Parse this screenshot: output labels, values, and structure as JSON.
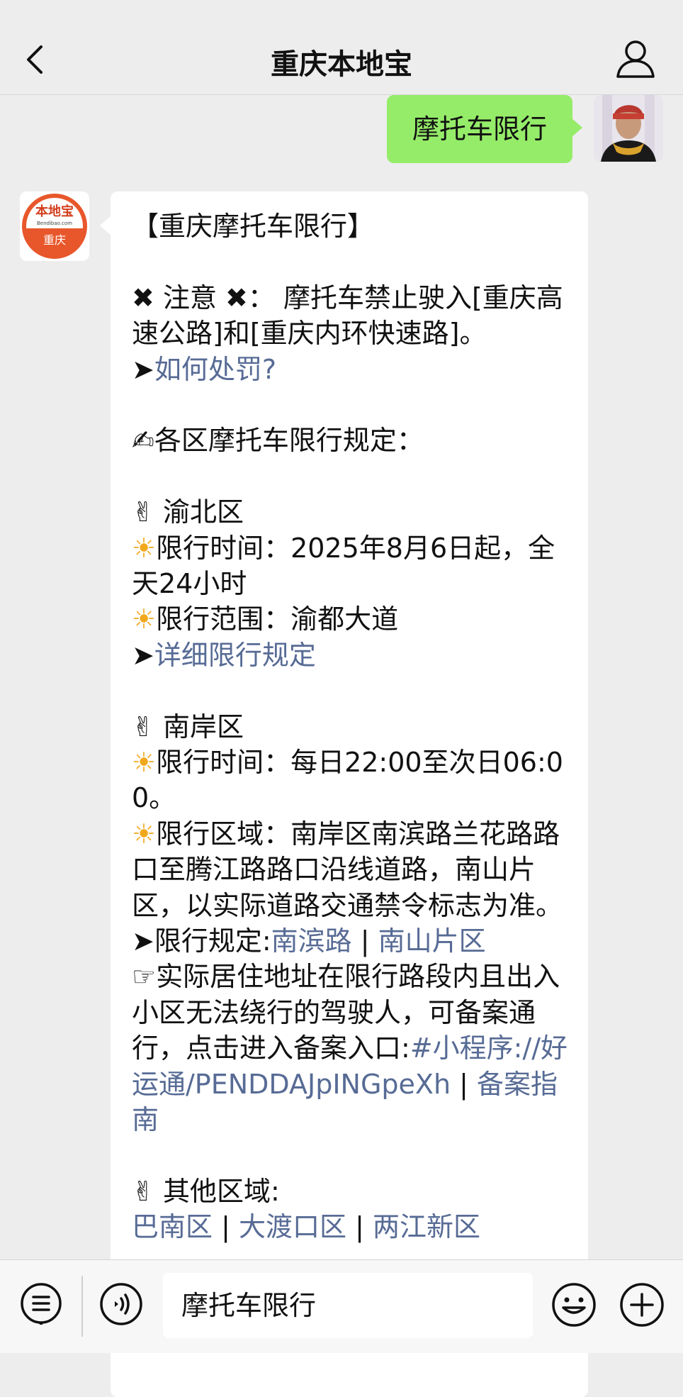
{
  "header": {
    "title": "重庆本地宝"
  },
  "user_message": {
    "text": "摩托车限行"
  },
  "bot_avatar": {
    "brand": "本地宝",
    "domain": "Bendibao.com",
    "city": "重庆"
  },
  "reply": {
    "title": "【重庆摩托车限行】",
    "notice_label": "注意",
    "notice_text": "摩托车禁止驶入[重庆高速公路]和[重庆内环快速路]。",
    "penalty_link": "如何处罚?",
    "rules_heading": "各区摩托车限行规定：",
    "yubei": {
      "name": "渝北区",
      "time": "限行时间：2025年8月6日起，全天24小时",
      "scope": "限行范围：渝都大道",
      "detail_link": "详细限行规定"
    },
    "nanan": {
      "name": "南岸区",
      "time": "限行时间：每日22:00至次日06:00。",
      "area": "限行区域：南岸区南滨路兰花路路口至腾江路路口沿线道路，南山片区，以实际道路交通禁令标志为准。",
      "rules_label": "限行规定:",
      "rule_link_1": "南滨路",
      "separator": " | ",
      "rule_link_2": "南山片区",
      "resident_text": "实际居住地址在限行路段内且出入小区无法绕行的驾驶人，可备案通行，点击进入备案入口:",
      "miniprogram_link": "#小程序://好运通/PENDDAJpINGpeXh",
      "guide_link": "备案指南"
    },
    "other": {
      "name": "其他区域:",
      "link_1": "巴南区",
      "link_2": "大渡口区",
      "link_3": "两江新区"
    }
  },
  "input": {
    "value": "摩托车限行"
  }
}
